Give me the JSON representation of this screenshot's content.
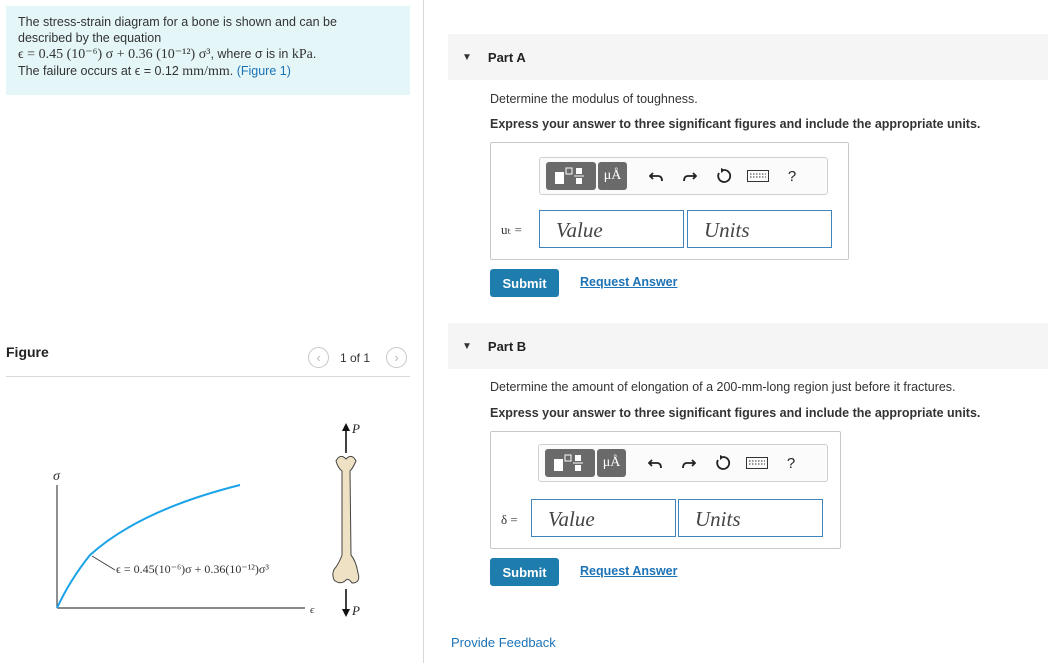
{
  "problem": {
    "line1": "The stress-strain diagram for a bone is shown and can be",
    "line2": "described by the equation",
    "equation": "ϵ = 0.45 (10⁻⁶) σ + 0.36 (10⁻¹²) σ³",
    "equation_suffix": ", where σ is in ",
    "unit_kpa": "kPa",
    "failure_text": "The failure occurs at ϵ = 0.12 ",
    "failure_unit": "mm/mm",
    "figure_link": "(Figure 1)"
  },
  "figure": {
    "heading": "Figure",
    "pager": "1 of 1",
    "prev_icon": "chevron-left-icon",
    "next_icon": "chevron-right-icon",
    "y_axis_label": "σ",
    "x_axis_label": "ϵ",
    "curve_label": "ϵ = 0.45(10⁻⁶)σ + 0.36(10⁻¹²)σ³",
    "load_top": "P",
    "load_bottom": "P",
    "curve_color": "#1aa3e8"
  },
  "partA": {
    "label": "Part A",
    "question": "Determine the modulus of toughness.",
    "instruction": "Express your answer to three significant figures and include the appropriate units.",
    "variable": "uₜ =",
    "value_placeholder": "Value",
    "units_placeholder": "Units",
    "submit": "Submit",
    "request": "Request Answer"
  },
  "partB": {
    "label": "Part B",
    "question": "Determine the amount of elongation of a 200-mm-long region just before it fractures.",
    "instruction": "Express your answer to three significant figures and include the appropriate units.",
    "variable": "δ =",
    "value_placeholder": "Value",
    "units_placeholder": "Units",
    "submit": "Submit",
    "request": "Request Answer"
  },
  "toolbar": {
    "mu_label": "μÅ",
    "help_label": "?",
    "icons": [
      "templates-icon",
      "units-icon",
      "undo-icon",
      "redo-icon",
      "reset-icon",
      "keyboard-icon",
      "help-icon"
    ]
  },
  "feedback": "Provide Feedback",
  "colors": {
    "accent": "#1f7dae",
    "link": "#1c73b6",
    "problem_bg": "#e5f6f9"
  }
}
